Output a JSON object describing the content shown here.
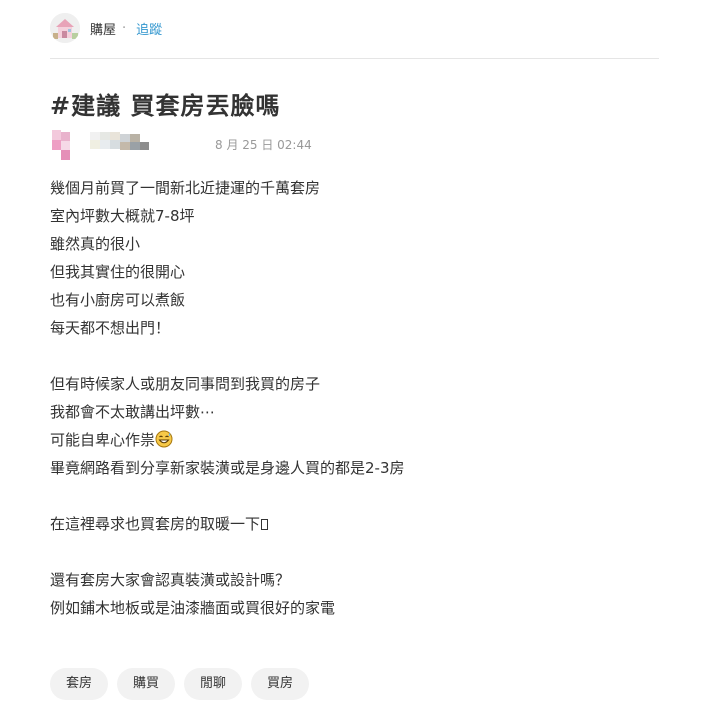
{
  "header": {
    "board_name": "購屋",
    "separator": "·",
    "follow_label": "追蹤"
  },
  "post": {
    "title": "#建議 買套房丟臉嗎",
    "date": "8 月 25 日 02:44",
    "lines": {
      "l1": "幾個月前買了一間新北近捷運的千萬套房",
      "l2": "室內坪數大概就7-8坪",
      "l3": "雖然真的很小",
      "l4": "但我其實住的很開心",
      "l5": "也有小廚房可以煮飯",
      "l6": "每天都不想出門！",
      "l7": "但有時候家人或朋友同事問到我買的房子",
      "l8": "我都會不太敢講出坪數⋯",
      "l9": "可能自卑心作祟",
      "l10": "畢竟網路看到分享新家裝潢或是身邊人買的都是2-3房",
      "l11": "在這裡尋求也買套房的取暖一下",
      "l12": "還有套房大家會認真裝潢或設計嗎？",
      "l13": "例如鋪木地板或是油漆牆面或買很好的家電"
    }
  },
  "tags": {
    "t1": "套房",
    "t2": "購買",
    "t3": "閒聊",
    "t4": "買房"
  },
  "icons": {
    "board_icon": "house-board-icon",
    "emoji": "grinning-sweat-emoji-icon",
    "missing_glyph": "missing-glyph-icon",
    "author": "pixelated-author-icon"
  },
  "colors": {
    "link": "#3397cf",
    "date": "#999999",
    "tag_bg": "#f2f2f2"
  }
}
